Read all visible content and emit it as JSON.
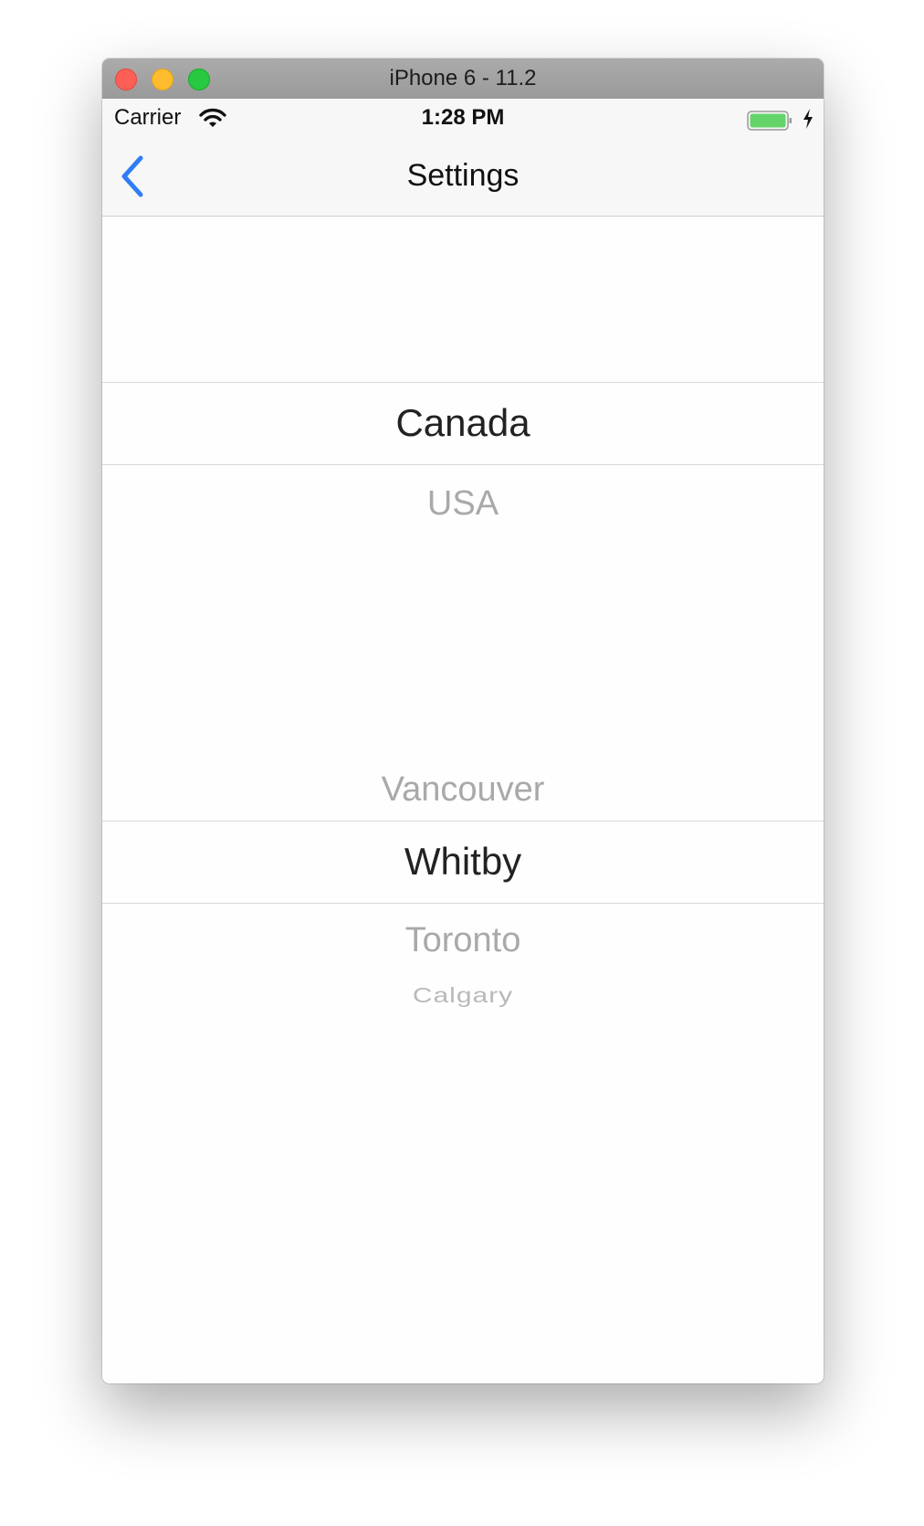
{
  "window": {
    "title": "iPhone 6 - 11.2"
  },
  "status_bar": {
    "carrier": "Carrier",
    "time": "1:28 PM",
    "icons": [
      "wifi-icon",
      "battery-icon",
      "charging-bolt-icon"
    ],
    "battery_color": "#64d46a"
  },
  "nav_bar": {
    "title": "Settings",
    "back_icon": "chevron-left-icon",
    "tint_color": "#2f7cf6"
  },
  "country_picker": {
    "options": [
      "Canada",
      "USA"
    ],
    "selected": "Canada"
  },
  "city_picker": {
    "options": [
      "Vancouver",
      "Whitby",
      "Toronto",
      "Calgary"
    ],
    "selected": "Whitby"
  }
}
